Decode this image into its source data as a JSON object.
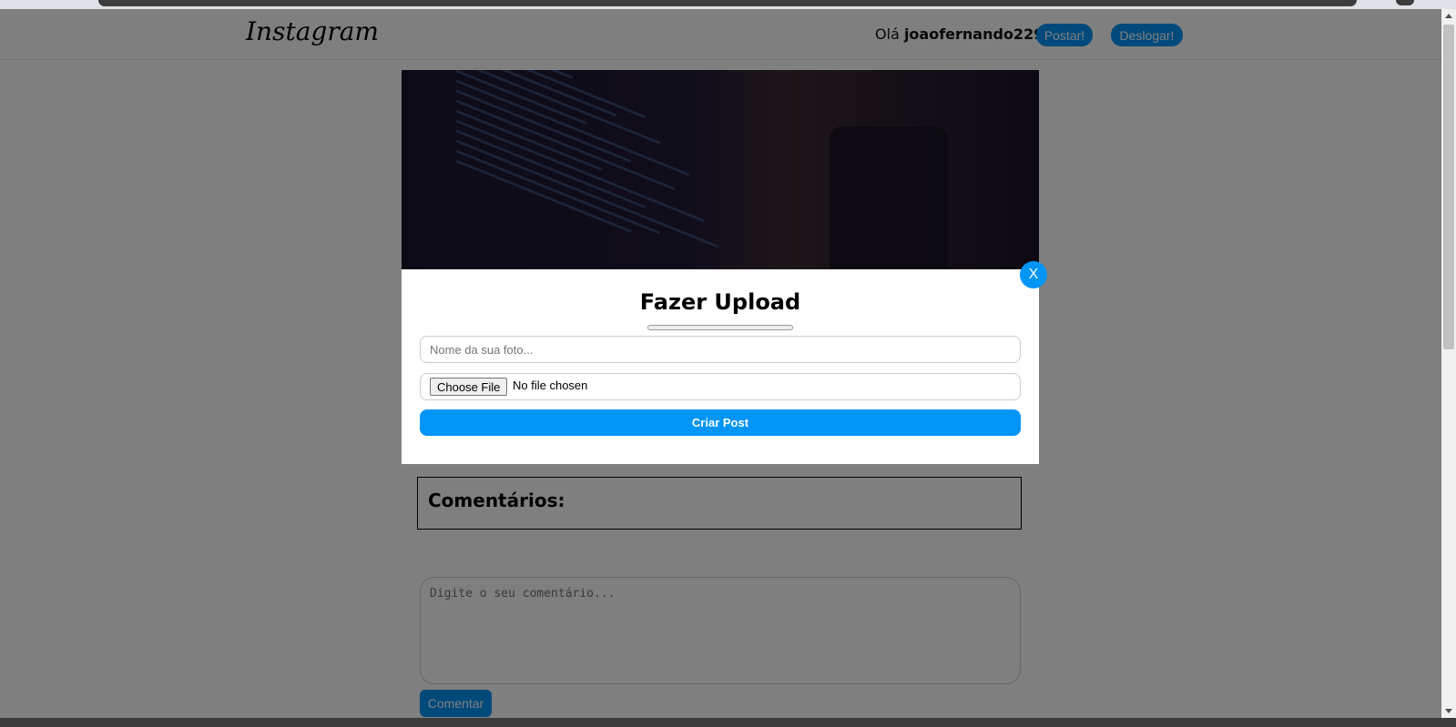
{
  "header": {
    "logo": "Instagram",
    "greeting_prefix": "Olá",
    "username": "joaofernando2299",
    "post_button": "Postar!",
    "logout_button": "Deslogar!"
  },
  "post": {
    "comments_title": "Comentários:",
    "comment_placeholder": "Digite o seu comentário...",
    "comment_button": "Comentar"
  },
  "modal": {
    "close_label": "X",
    "title": "Fazer Upload",
    "progress": 0,
    "name_placeholder": "Nome da sua foto...",
    "file_button": "Choose File",
    "file_status": "No file chosen",
    "submit_button": "Criar Post"
  },
  "colors": {
    "accent": "#0095f6",
    "overlay": "rgba(0,0,0,0.5)"
  }
}
